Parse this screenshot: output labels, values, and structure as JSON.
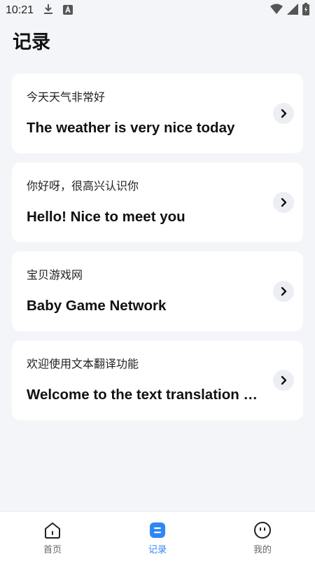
{
  "status_bar": {
    "time": "10:21",
    "left_icons": [
      "download-icon",
      "notification-app-icon"
    ],
    "right_icons": [
      "wifi-icon",
      "signal-icon",
      "battery-icon"
    ]
  },
  "page": {
    "title": "记录"
  },
  "records": [
    {
      "source": "今天天气非常好",
      "translation": "The weather is very nice today"
    },
    {
      "source": "你好呀，很高兴认识你",
      "translation": "Hello! Nice to meet you"
    },
    {
      "source": "宝贝游戏网",
      "translation": "Baby Game Network"
    },
    {
      "source": "欢迎使用文本翻译功能",
      "translation": "Welcome to the text translation …"
    }
  ],
  "bottom_nav": {
    "items": [
      {
        "label": "首页",
        "icon": "home-icon",
        "active": false
      },
      {
        "label": "记录",
        "icon": "records-icon",
        "active": true
      },
      {
        "label": "我的",
        "icon": "profile-icon",
        "active": false
      }
    ]
  },
  "colors": {
    "accent": "#2f86f5",
    "background": "#f3f5f8",
    "card": "#ffffff",
    "arrow_circle": "#eceef3"
  }
}
